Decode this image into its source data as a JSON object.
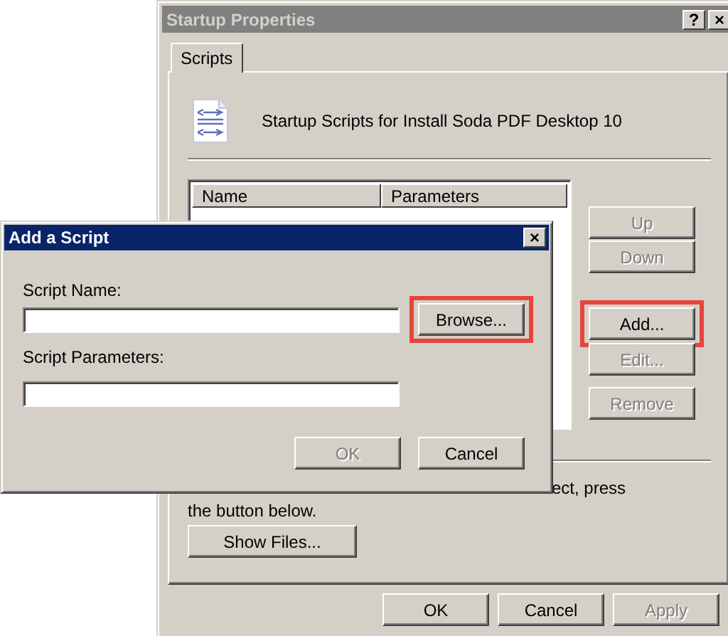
{
  "main_window": {
    "title": "Startup Properties",
    "title_buttons": [
      "?",
      "×"
    ],
    "tabs": [
      {
        "label": "Scripts",
        "selected": true
      }
    ],
    "heading": "Startup Scripts for Install Soda PDF Desktop 10",
    "list": {
      "columns": [
        "Name",
        "Parameters"
      ]
    },
    "side_buttons": [
      {
        "label": "Up",
        "disabled": true,
        "highlighted": false
      },
      {
        "label": "Down",
        "disabled": true,
        "highlighted": false
      },
      {
        "label": "Add...",
        "disabled": false,
        "highlighted": true
      },
      {
        "label": "Edit...",
        "disabled": true,
        "highlighted": false
      },
      {
        "label": "Remove",
        "disabled": true,
        "highlighted": false
      }
    ],
    "note_lines": [
      "ect, press",
      "the button below."
    ],
    "show_files_button": {
      "label": "Show Files...",
      "disabled": false
    },
    "footer_buttons": [
      {
        "label": "OK",
        "disabled": false
      },
      {
        "label": "Cancel",
        "disabled": false
      },
      {
        "label": "Apply",
        "disabled": true
      }
    ]
  },
  "dialog": {
    "title": "Add a Script",
    "close_button": "×",
    "fields": [
      {
        "label": "Script Name:"
      },
      {
        "label": "Script Parameters:"
      }
    ],
    "browse_button": {
      "label": "Browse...",
      "disabled": false,
      "highlighted": true
    },
    "buttons": [
      {
        "label": "OK",
        "disabled": true
      },
      {
        "label": "Cancel",
        "disabled": false
      }
    ]
  }
}
